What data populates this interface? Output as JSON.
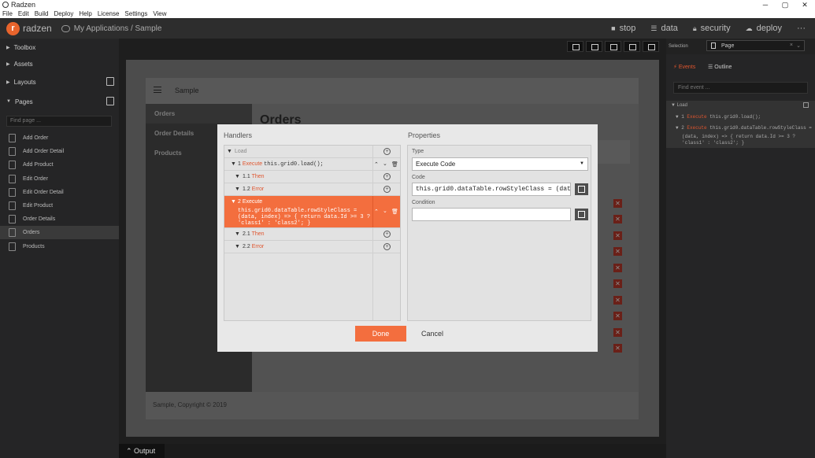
{
  "window": {
    "title": "Radzen",
    "minimize": "─",
    "maximize": "▢",
    "close": "✕"
  },
  "menu": [
    "File",
    "Edit",
    "Build",
    "Deploy",
    "Help",
    "License",
    "Settings",
    "View"
  ],
  "header": {
    "logo_text": "radzen",
    "breadcrumb": "My Applications / Sample",
    "actions": [
      {
        "label": "stop",
        "icon": "stop-icon"
      },
      {
        "label": "data",
        "icon": "database-icon"
      },
      {
        "label": "security",
        "icon": "lock-icon"
      },
      {
        "label": "deploy",
        "icon": "cloud-icon"
      }
    ],
    "more": "···"
  },
  "sidebar": {
    "sections": [
      "Toolbox",
      "Assets",
      "Layouts",
      "Pages"
    ],
    "find_placeholder": "Find page ...",
    "pages": [
      "Add Order",
      "Add Order Detail",
      "Add Product",
      "Edit Order",
      "Edit Order Detail",
      "Edit Product",
      "Order Details",
      "Orders",
      "Products"
    ],
    "selected_page": "Orders"
  },
  "preview": {
    "title": "Sample",
    "heading": "Orders",
    "nav": [
      "Orders",
      "Order Details",
      "Products"
    ],
    "footer": "Sample, Copyright © 2019",
    "delete_glyph": "✕"
  },
  "dialog": {
    "handlers_title": "Handlers",
    "properties_title": "Properties",
    "handlers": {
      "event": "Load",
      "rows": [
        {
          "num": "1",
          "kind": "Execute",
          "code": "this.grid0.load();"
        },
        {
          "num": "1.1",
          "kind": "Then"
        },
        {
          "num": "1.2",
          "kind": "Error"
        },
        {
          "num": "2",
          "kind": "Execute",
          "code": "this.grid0.dataTable.rowStyleClass = (data, index) => { return data.Id >= 3 ? 'class1' : 'class2'; }"
        },
        {
          "num": "2.1",
          "kind": "Then"
        },
        {
          "num": "2.2",
          "kind": "Error"
        }
      ]
    },
    "properties": {
      "type_label": "Type",
      "type_value": "Execute Code",
      "code_label": "Code",
      "code_value": "this.grid0.dataTable.rowStyleClass = (data,",
      "condition_label": "Condition",
      "condition_value": ""
    },
    "done": "Done",
    "cancel": "Cancel"
  },
  "right_panel": {
    "selection_label": "Selection",
    "selection_value": "Page",
    "clear": "×",
    "dropdown": "⌄",
    "tabs": [
      "Events",
      "Outline"
    ],
    "find_placeholder": "Find event ...",
    "tree": {
      "event": "Load",
      "row1_num": "1",
      "row1_kind": "Execute",
      "row1_code": "this.grid0.load();",
      "row2_num": "2",
      "row2_kind": "Execute",
      "row2_code": "this.grid0.dataTable.rowStyleClass =",
      "row2_line2": "(data, index) => { return data.Id >= 3 ?",
      "row2_line3": "'class1' : 'class2'; }"
    }
  },
  "output_tab": "Output",
  "colors": {
    "accent": "#f36e3e",
    "brand": "#e8642c",
    "delete": "#c23b2c"
  }
}
